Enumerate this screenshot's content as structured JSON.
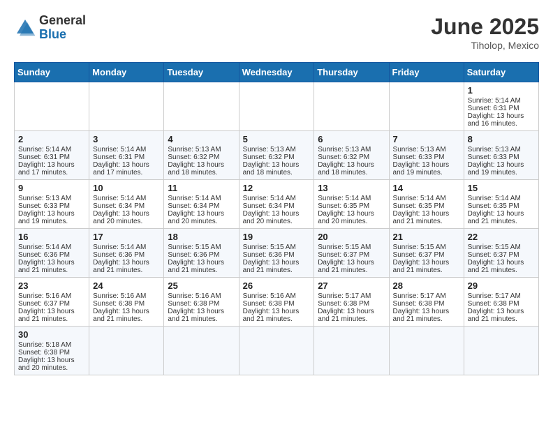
{
  "header": {
    "logo_general": "General",
    "logo_blue": "Blue",
    "month_title": "June 2025",
    "location": "Tiholop, Mexico"
  },
  "weekdays": [
    "Sunday",
    "Monday",
    "Tuesday",
    "Wednesday",
    "Thursday",
    "Friday",
    "Saturday"
  ],
  "days": [
    {
      "date": "",
      "empty": true
    },
    {
      "date": "",
      "empty": true
    },
    {
      "date": "",
      "empty": true
    },
    {
      "date": "",
      "empty": true
    },
    {
      "date": "",
      "empty": true
    },
    {
      "date": "",
      "empty": true
    },
    {
      "num": "1",
      "sunrise": "Sunrise: 5:14 AM",
      "sunset": "Sunset: 6:31 PM",
      "daylight": "Daylight: 13 hours and 16 minutes."
    },
    {
      "num": "2",
      "sunrise": "Sunrise: 5:14 AM",
      "sunset": "Sunset: 6:31 PM",
      "daylight": "Daylight: 13 hours and 17 minutes."
    },
    {
      "num": "3",
      "sunrise": "Sunrise: 5:14 AM",
      "sunset": "Sunset: 6:31 PM",
      "daylight": "Daylight: 13 hours and 17 minutes."
    },
    {
      "num": "4",
      "sunrise": "Sunrise: 5:13 AM",
      "sunset": "Sunset: 6:32 PM",
      "daylight": "Daylight: 13 hours and 18 minutes."
    },
    {
      "num": "5",
      "sunrise": "Sunrise: 5:13 AM",
      "sunset": "Sunset: 6:32 PM",
      "daylight": "Daylight: 13 hours and 18 minutes."
    },
    {
      "num": "6",
      "sunrise": "Sunrise: 5:13 AM",
      "sunset": "Sunset: 6:32 PM",
      "daylight": "Daylight: 13 hours and 18 minutes."
    },
    {
      "num": "7",
      "sunrise": "Sunrise: 5:13 AM",
      "sunset": "Sunset: 6:33 PM",
      "daylight": "Daylight: 13 hours and 19 minutes."
    },
    {
      "num": "8",
      "sunrise": "Sunrise: 5:13 AM",
      "sunset": "Sunset: 6:33 PM",
      "daylight": "Daylight: 13 hours and 19 minutes."
    },
    {
      "num": "9",
      "sunrise": "Sunrise: 5:13 AM",
      "sunset": "Sunset: 6:33 PM",
      "daylight": "Daylight: 13 hours and 19 minutes."
    },
    {
      "num": "10",
      "sunrise": "Sunrise: 5:14 AM",
      "sunset": "Sunset: 6:34 PM",
      "daylight": "Daylight: 13 hours and 20 minutes."
    },
    {
      "num": "11",
      "sunrise": "Sunrise: 5:14 AM",
      "sunset": "Sunset: 6:34 PM",
      "daylight": "Daylight: 13 hours and 20 minutes."
    },
    {
      "num": "12",
      "sunrise": "Sunrise: 5:14 AM",
      "sunset": "Sunset: 6:34 PM",
      "daylight": "Daylight: 13 hours and 20 minutes."
    },
    {
      "num": "13",
      "sunrise": "Sunrise: 5:14 AM",
      "sunset": "Sunset: 6:35 PM",
      "daylight": "Daylight: 13 hours and 20 minutes."
    },
    {
      "num": "14",
      "sunrise": "Sunrise: 5:14 AM",
      "sunset": "Sunset: 6:35 PM",
      "daylight": "Daylight: 13 hours and 21 minutes."
    },
    {
      "num": "15",
      "sunrise": "Sunrise: 5:14 AM",
      "sunset": "Sunset: 6:35 PM",
      "daylight": "Daylight: 13 hours and 21 minutes."
    },
    {
      "num": "16",
      "sunrise": "Sunrise: 5:14 AM",
      "sunset": "Sunset: 6:36 PM",
      "daylight": "Daylight: 13 hours and 21 minutes."
    },
    {
      "num": "17",
      "sunrise": "Sunrise: 5:14 AM",
      "sunset": "Sunset: 6:36 PM",
      "daylight": "Daylight: 13 hours and 21 minutes."
    },
    {
      "num": "18",
      "sunrise": "Sunrise: 5:15 AM",
      "sunset": "Sunset: 6:36 PM",
      "daylight": "Daylight: 13 hours and 21 minutes."
    },
    {
      "num": "19",
      "sunrise": "Sunrise: 5:15 AM",
      "sunset": "Sunset: 6:36 PM",
      "daylight": "Daylight: 13 hours and 21 minutes."
    },
    {
      "num": "20",
      "sunrise": "Sunrise: 5:15 AM",
      "sunset": "Sunset: 6:37 PM",
      "daylight": "Daylight: 13 hours and 21 minutes."
    },
    {
      "num": "21",
      "sunrise": "Sunrise: 5:15 AM",
      "sunset": "Sunset: 6:37 PM",
      "daylight": "Daylight: 13 hours and 21 minutes."
    },
    {
      "num": "22",
      "sunrise": "Sunrise: 5:15 AM",
      "sunset": "Sunset: 6:37 PM",
      "daylight": "Daylight: 13 hours and 21 minutes."
    },
    {
      "num": "23",
      "sunrise": "Sunrise: 5:16 AM",
      "sunset": "Sunset: 6:37 PM",
      "daylight": "Daylight: 13 hours and 21 minutes."
    },
    {
      "num": "24",
      "sunrise": "Sunrise: 5:16 AM",
      "sunset": "Sunset: 6:38 PM",
      "daylight": "Daylight: 13 hours and 21 minutes."
    },
    {
      "num": "25",
      "sunrise": "Sunrise: 5:16 AM",
      "sunset": "Sunset: 6:38 PM",
      "daylight": "Daylight: 13 hours and 21 minutes."
    },
    {
      "num": "26",
      "sunrise": "Sunrise: 5:16 AM",
      "sunset": "Sunset: 6:38 PM",
      "daylight": "Daylight: 13 hours and 21 minutes."
    },
    {
      "num": "27",
      "sunrise": "Sunrise: 5:17 AM",
      "sunset": "Sunset: 6:38 PM",
      "daylight": "Daylight: 13 hours and 21 minutes."
    },
    {
      "num": "28",
      "sunrise": "Sunrise: 5:17 AM",
      "sunset": "Sunset: 6:38 PM",
      "daylight": "Daylight: 13 hours and 21 minutes."
    },
    {
      "num": "29",
      "sunrise": "Sunrise: 5:17 AM",
      "sunset": "Sunset: 6:38 PM",
      "daylight": "Daylight: 13 hours and 21 minutes."
    },
    {
      "num": "30",
      "sunrise": "Sunrise: 5:18 AM",
      "sunset": "Sunset: 6:38 PM",
      "daylight": "Daylight: 13 hours and 20 minutes."
    }
  ]
}
